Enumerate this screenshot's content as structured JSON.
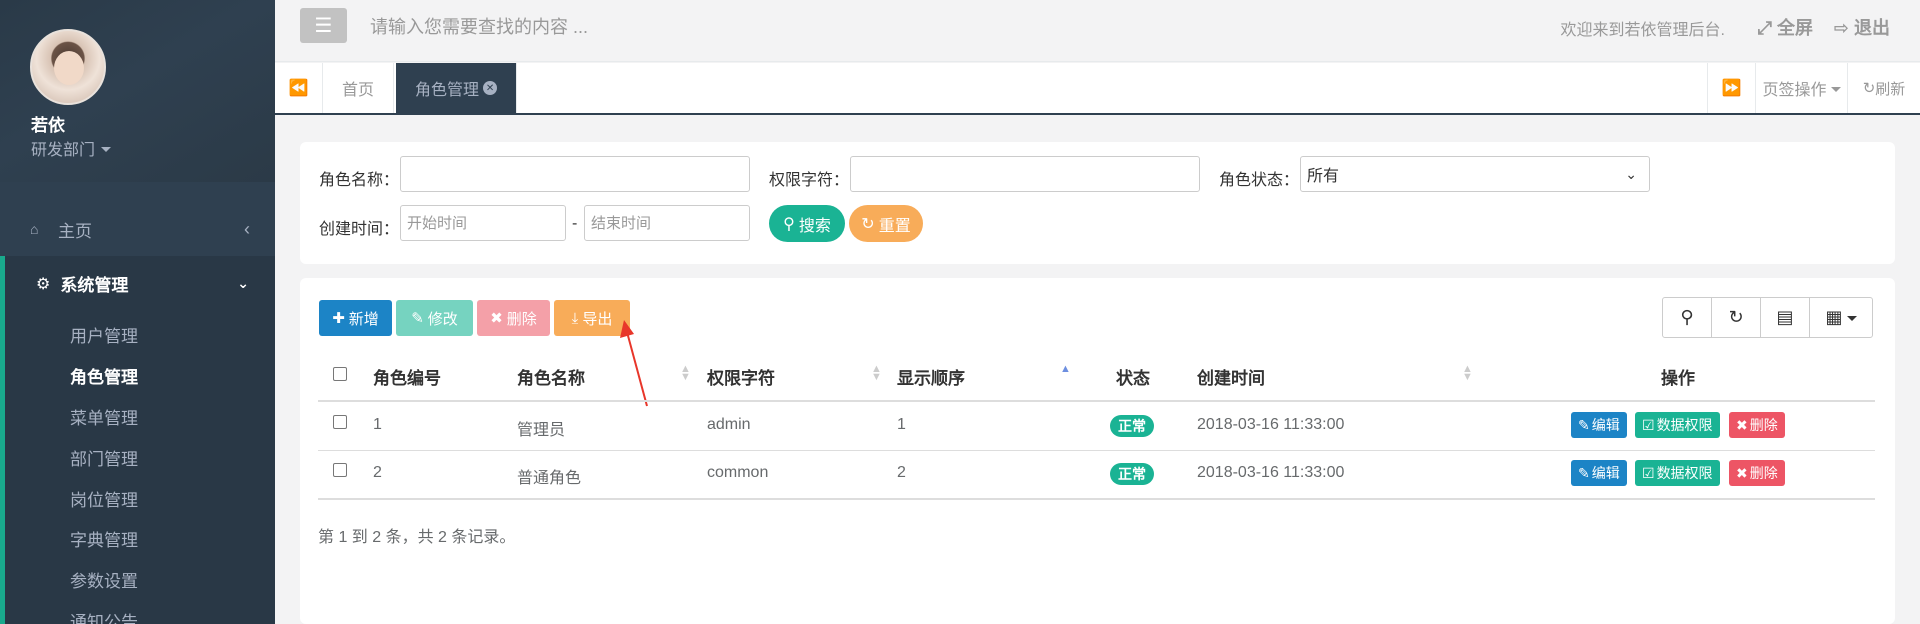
{
  "sidebar": {
    "user_name": "若依",
    "user_dept": "研发部门",
    "home_label": "主页",
    "system_label": "系统管理",
    "items": [
      {
        "label": "用户管理"
      },
      {
        "label": "角色管理"
      },
      {
        "label": "菜单管理"
      },
      {
        "label": "部门管理"
      },
      {
        "label": "岗位管理"
      },
      {
        "label": "字典管理"
      },
      {
        "label": "参数设置"
      },
      {
        "label": "通知公告"
      }
    ],
    "active_item": "角色管理"
  },
  "topbar": {
    "search_placeholder": "请输入您需要查找的内容 ...",
    "welcome": "欢迎来到若依管理后台.",
    "fullscreen": "全屏",
    "logout": "退出"
  },
  "tabs": {
    "items": [
      {
        "label": "首页"
      },
      {
        "label": "角色管理"
      }
    ],
    "ops": "页签操作",
    "refresh": "刷新"
  },
  "filter": {
    "role_name_label": "角色名称：",
    "perm_label": "权限字符：",
    "status_label": "角色状态：",
    "status_value": "所有",
    "created_label": "创建时间：",
    "start_placeholder": "开始时间",
    "end_placeholder": "结束时间",
    "date_sep": "-",
    "search_btn": "搜索",
    "reset_btn": "重置"
  },
  "toolbar": {
    "add": "新增",
    "edit": "修改",
    "delete": "删除",
    "export": "导出"
  },
  "table": {
    "columns": [
      "角色编号",
      "角色名称",
      "权限字符",
      "显示顺序",
      "状态",
      "创建时间",
      "操作"
    ],
    "rows": [
      {
        "id": "1",
        "name": "管理员",
        "key": "admin",
        "sort": "1",
        "status": "正常",
        "created": "2018-03-16 11:33:00"
      },
      {
        "id": "2",
        "name": "普通角色",
        "key": "common",
        "sort": "2",
        "status": "正常",
        "created": "2018-03-16 11:33:00"
      }
    ],
    "op_edit": "编辑",
    "op_data": "数据权限",
    "op_delete": "删除",
    "summary": "第 1 到 2 条，共 2 条记录。"
  },
  "colors": {
    "sidebar_bg": "#2f4050",
    "accent_green": "#1ab394",
    "primary_blue": "#1c84c6",
    "warning_orange": "#f8ac59",
    "danger_red": "#ed5565"
  }
}
